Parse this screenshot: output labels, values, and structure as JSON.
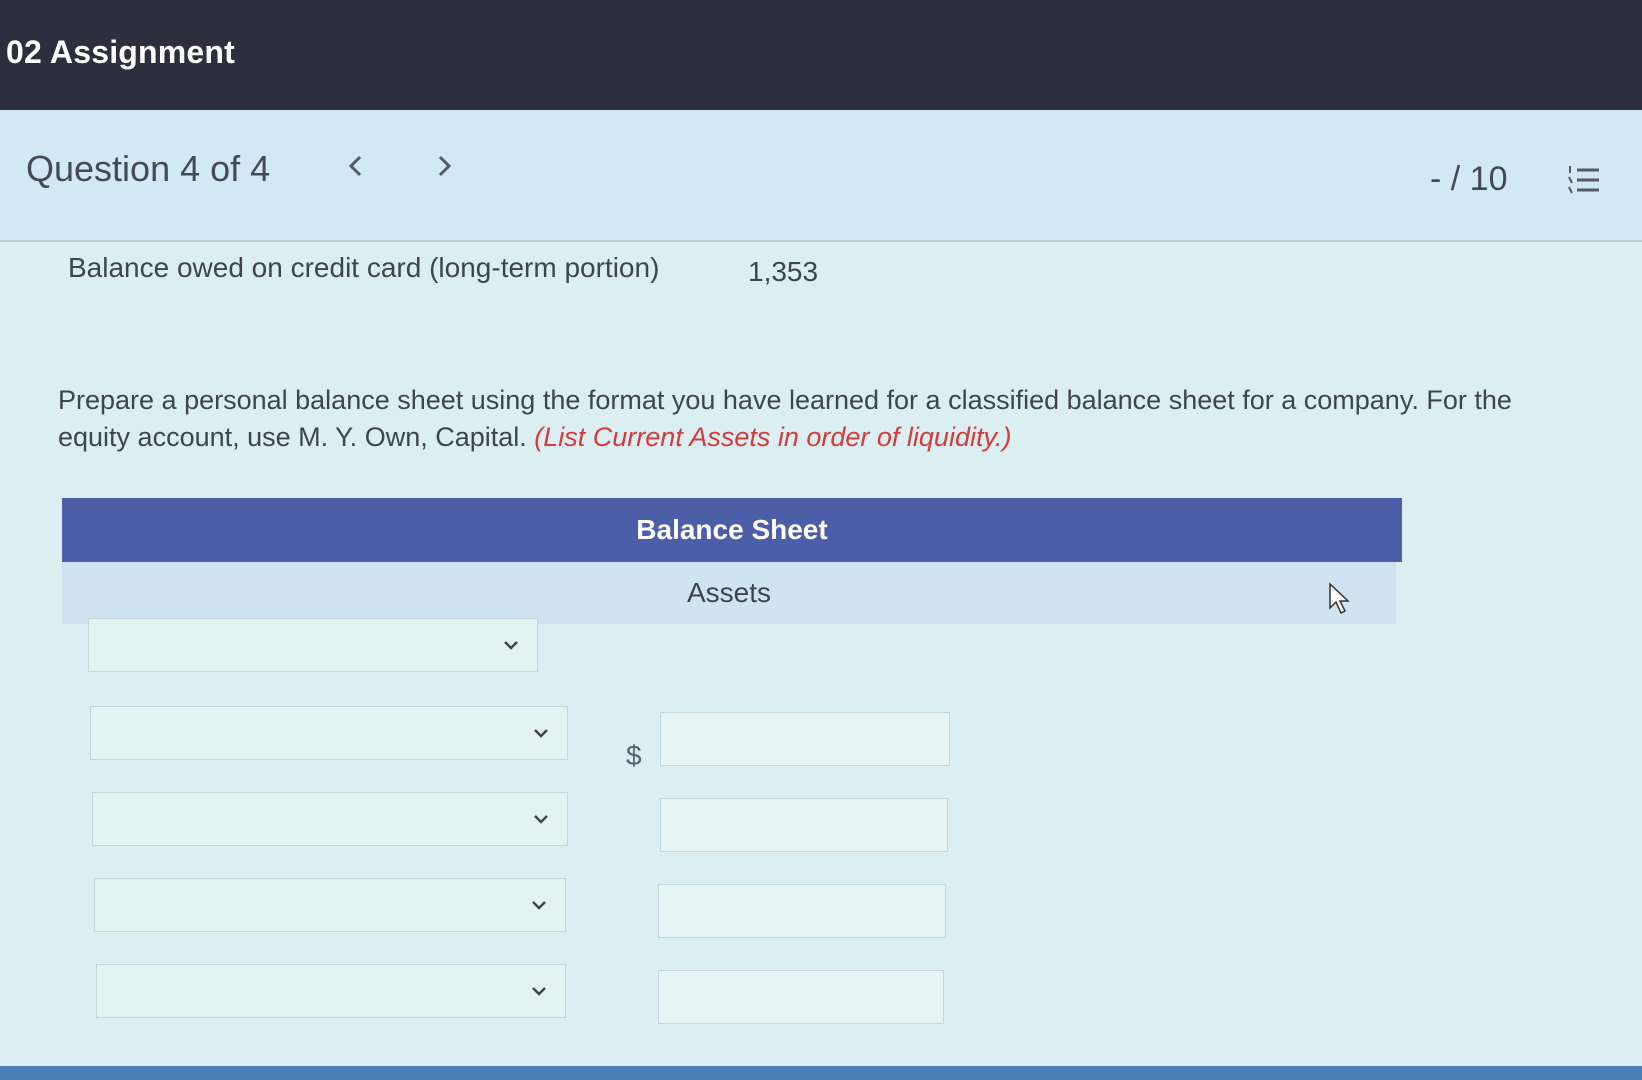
{
  "app": {
    "title": "02 Assignment"
  },
  "question": {
    "counter": "Question 4 of 4",
    "prev_icon": "chevron-left-icon",
    "next_icon": "chevron-right-icon",
    "score": "- / 10",
    "menu_icon": "numbered-list-icon"
  },
  "data_row": {
    "label": "Balance owed on credit card (long-term portion)",
    "value": "1,353"
  },
  "instructions": {
    "text": "Prepare a personal balance sheet using the format you have learned for a classified balance sheet for a company. For the equity account, use M. Y. Own, Capital.",
    "hint": "(List Current Assets in order of liquidity.)"
  },
  "balance_sheet": {
    "title": "Balance Sheet",
    "section": "Assets",
    "currency_symbol": "$",
    "rows": [
      {
        "dropdown_value": "",
        "amount": ""
      },
      {
        "dropdown_value": "",
        "amount": ""
      },
      {
        "dropdown_value": "",
        "amount": ""
      },
      {
        "dropdown_value": "",
        "amount": ""
      },
      {
        "dropdown_value": "",
        "amount": ""
      }
    ]
  },
  "colors": {
    "topbar": "#2d2f3e",
    "table_header": "#4c5ea8",
    "hint_red": "#d63a3a"
  }
}
